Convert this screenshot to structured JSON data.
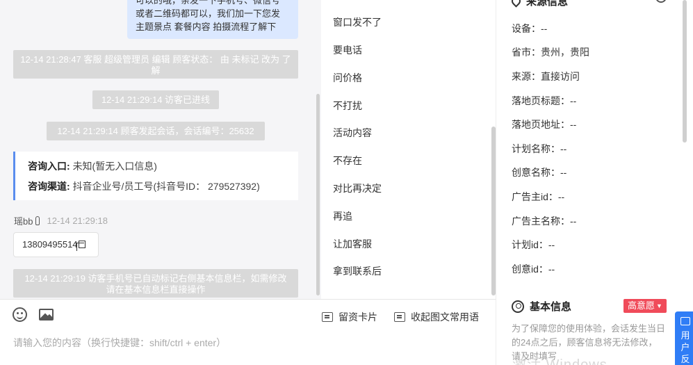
{
  "chat": {
    "agent_bubble_lines": [
      "可以的哦，亲发一下手机号、微信号",
      "或者二维码都可以，我们加一下您发",
      "主题景点 套餐内容 拍摄流程了解下"
    ],
    "sys_msgs": [
      "12-14 21:28:47 客服 超级管理员 编辑 顾客状态： 由 未标记 改为 了解",
      "12-14 21:29:14 访客已进线",
      "12-14 21:29:14 顾客发起会话，会话编号：25632",
      "12-14 21:29:19 访客手机号已自动标记右侧基本信息栏，如需修改请在基本信息栏直接操作"
    ],
    "info_card": {
      "entry_label": "咨询入口:",
      "entry_value": "未知(暂无入口信息)",
      "channel_label": "咨询渠道:",
      "channel_value": "抖音企业号/员工号(抖音号ID： 279527392)"
    },
    "sender_name": "瑶bb",
    "sender_time": "12-14 21:29:18",
    "phone_number": "13809495514"
  },
  "composer": {
    "card_button": "留资卡片",
    "collapse_button": "收起图文常用语",
    "placeholder": "请输入您的内容（换行快捷键：shift/ctrl + enter）"
  },
  "phrases": [
    "窗口发不了",
    "要电话",
    "问价格",
    "不打扰",
    "活动内容",
    "不存在",
    "对比再决定",
    "再追",
    "让加客服",
    "拿到联系后"
  ],
  "right_panel": {
    "source_title": "来源信息",
    "source_fields": [
      "设备：--",
      "省市：贵州，贵阳",
      "来源：直接访问",
      "落地页标题：--",
      "落地页地址：--",
      "计划名称：--",
      "创意名称：--",
      "广告主id：--",
      "广告主名称：--",
      "计划id：--",
      "创意id：--"
    ],
    "basic_title": "基本信息",
    "intent_badge": "高意愿",
    "note": "为了保障您的使用体验，会话发生当日的24点之后，顾客信息将无法修改，请及时填写",
    "watermark": "激活 Windows",
    "feedback_label": "用户反"
  }
}
